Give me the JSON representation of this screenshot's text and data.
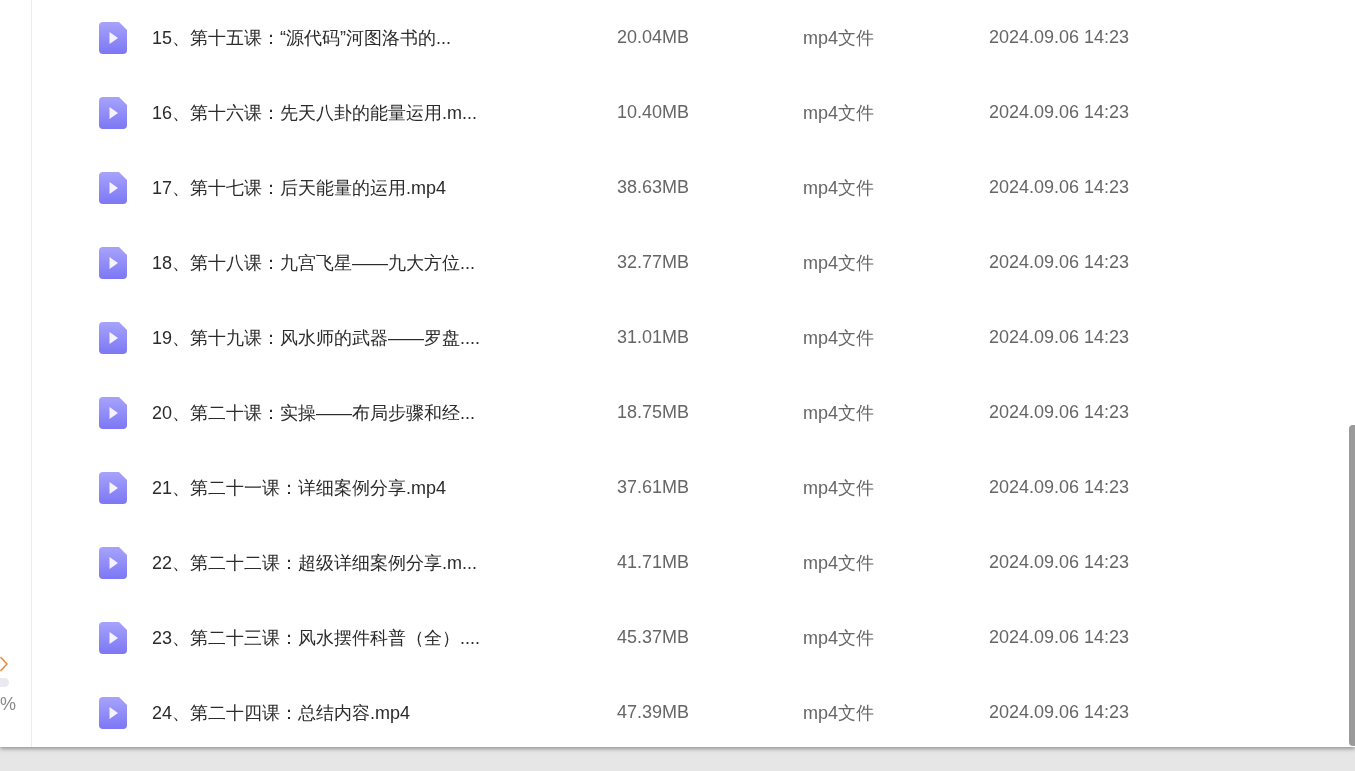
{
  "sidebar": {
    "percent_text": "%"
  },
  "file_list": {
    "rows": [
      {
        "name": "15、第十五课：“源代码”河图洛书的...",
        "size": "20.04MB",
        "type": "mp4文件",
        "modified": "2024.09.06 14:23"
      },
      {
        "name": "16、第十六课：先天八卦的能量运用.m...",
        "size": "10.40MB",
        "type": "mp4文件",
        "modified": "2024.09.06 14:23"
      },
      {
        "name": "17、第十七课：后天能量的运用.mp4",
        "size": "38.63MB",
        "type": "mp4文件",
        "modified": "2024.09.06 14:23"
      },
      {
        "name": "18、第十八课：九宫飞星——九大方位...",
        "size": "32.77MB",
        "type": "mp4文件",
        "modified": "2024.09.06 14:23"
      },
      {
        "name": "19、第十九课：风水师的武器——罗盘....",
        "size": "31.01MB",
        "type": "mp4文件",
        "modified": "2024.09.06 14:23"
      },
      {
        "name": "20、第二十课：实操——布局步骤和经...",
        "size": "18.75MB",
        "type": "mp4文件",
        "modified": "2024.09.06 14:23"
      },
      {
        "name": "21、第二十一课：详细案例分享.mp4",
        "size": "37.61MB",
        "type": "mp4文件",
        "modified": "2024.09.06 14:23"
      },
      {
        "name": "22、第二十二课：超级详细案例分享.m...",
        "size": "41.71MB",
        "type": "mp4文件",
        "modified": "2024.09.06 14:23"
      },
      {
        "name": "23、第二十三课：风水摆件科普（全）....",
        "size": "45.37MB",
        "type": "mp4文件",
        "modified": "2024.09.06 14:23"
      },
      {
        "name": "24、第二十四课：总结内容.mp4",
        "size": "47.39MB",
        "type": "mp4文件",
        "modified": "2024.09.06 14:23"
      }
    ]
  }
}
